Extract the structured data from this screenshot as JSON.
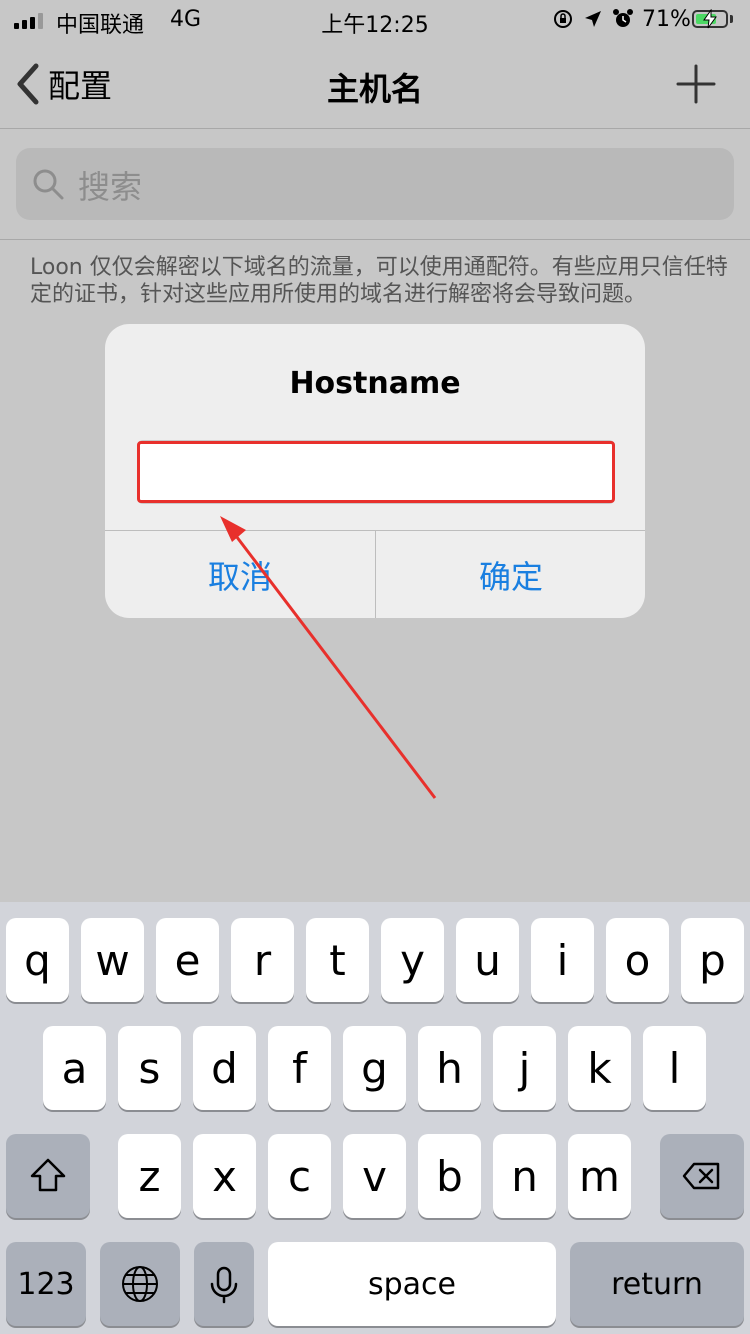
{
  "status_bar": {
    "carrier": "中国联通",
    "network": "4G",
    "time": "上午12:25",
    "battery_percent": "71%",
    "battery_level": 0.71,
    "icons": [
      "orientation-lock-icon",
      "location-icon",
      "alarm-icon"
    ]
  },
  "nav": {
    "back_label": "配置",
    "title": "主机名",
    "add_icon": "plus-icon"
  },
  "search": {
    "placeholder": "搜索"
  },
  "description": "Loon 仅仅会解密以下域名的流量，可以使用通配符。有些应用只信任特定的证书，针对这些应用所使用的域名进行解密将会导致问题。",
  "alert": {
    "title": "Hostname",
    "input_value": "",
    "cancel_label": "取消",
    "confirm_label": "确定"
  },
  "keyboard": {
    "row1": [
      "q",
      "w",
      "e",
      "r",
      "t",
      "y",
      "u",
      "i",
      "o",
      "p"
    ],
    "row2": [
      "a",
      "s",
      "d",
      "f",
      "g",
      "h",
      "j",
      "k",
      "l"
    ],
    "row3": [
      "z",
      "x",
      "c",
      "v",
      "b",
      "n",
      "m"
    ],
    "numbers_label": "123",
    "space_label": "space",
    "return_label": "return"
  },
  "colors": {
    "accent": "#1a7fe0",
    "annotation": "#e8302c"
  }
}
